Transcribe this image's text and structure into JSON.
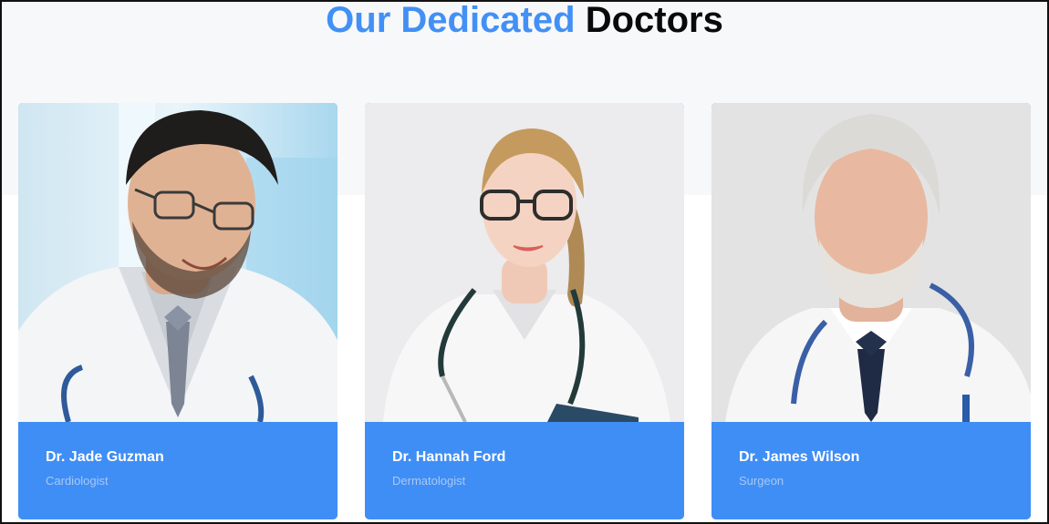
{
  "section": {
    "title_accent": "Our Dedicated",
    "title_rest": "Doctors"
  },
  "doctors": [
    {
      "name": "Dr. Jade Guzman",
      "specialty": "Cardiologist"
    },
    {
      "name": "Dr. Hannah Ford",
      "specialty": "Dermatologist"
    },
    {
      "name": "Dr. James Wilson",
      "specialty": "Surgeon"
    }
  ],
  "colors": {
    "accent": "#4290f5",
    "card_footer": "#3f8ef5",
    "specialty_text": "#a8c8f5",
    "band": "#f7f8fa"
  }
}
